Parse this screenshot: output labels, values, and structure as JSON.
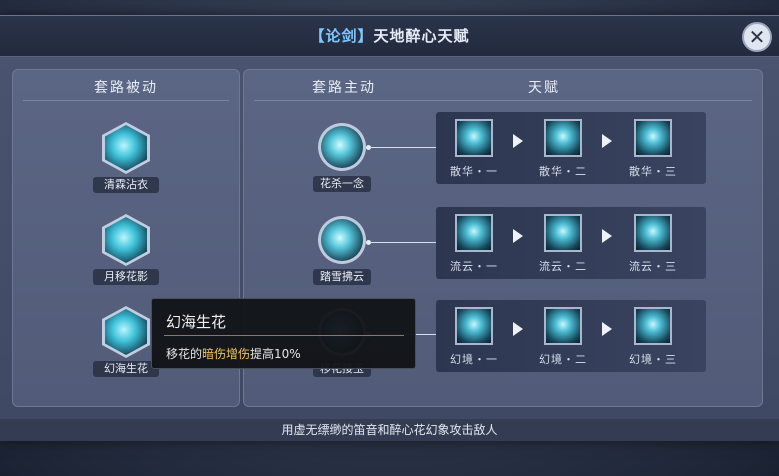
{
  "window": {
    "title_tag": "【论剑】",
    "title_text": "天地醉心天赋",
    "close_glyph": "✕"
  },
  "passive": {
    "header": "套路被动",
    "skills": [
      {
        "name": "清霖沾衣",
        "icon": "water-splash-icon"
      },
      {
        "name": "月移花影",
        "icon": "moon-shadow-icon"
      },
      {
        "name": "幻海生花",
        "icon": "illusion-flower-icon"
      }
    ]
  },
  "active": {
    "header": "套路主动",
    "skills": [
      {
        "name": "花杀一念",
        "icon": "flower-strike-icon"
      },
      {
        "name": "踏雪拂云",
        "icon": "snow-step-icon"
      },
      {
        "name": "移花接玉",
        "icon": "flower-transfer-icon"
      }
    ]
  },
  "talents": {
    "header": "天赋",
    "rows": [
      [
        "散华・一",
        "散华・二",
        "散华・三"
      ],
      [
        "流云・一",
        "流云・二",
        "流云・三"
      ],
      [
        "幻境・一",
        "幻境・二",
        "幻境・三"
      ]
    ]
  },
  "tooltip": {
    "title": "幻海生花",
    "desc_prefix": "移花的",
    "desc_highlight": "暗伤增伤",
    "desc_suffix": "提高10%"
  },
  "footer": {
    "text": "用虚无缥缈的笛音和醉心花幻象攻击敌人"
  },
  "colors": {
    "accent": "#7fc7ff",
    "highlight": "#f2c35a"
  }
}
